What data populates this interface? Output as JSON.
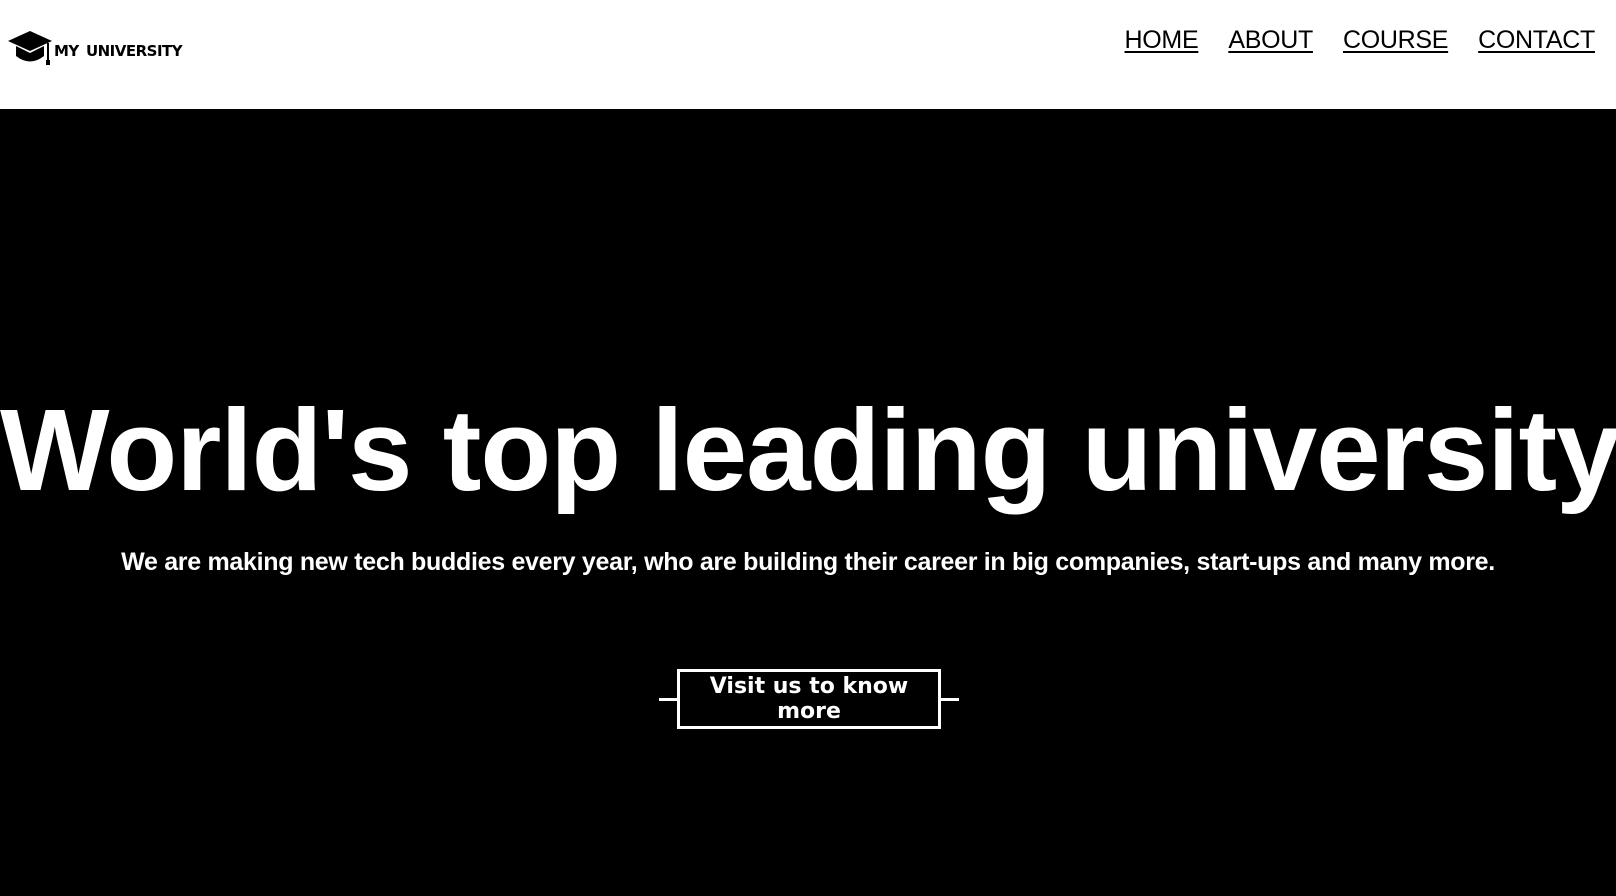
{
  "brand": {
    "name": "my university",
    "icon": "graduation-cap-icon"
  },
  "nav": {
    "items": [
      {
        "label": "HOME"
      },
      {
        "label": "ABOUT"
      },
      {
        "label": "COURSE"
      },
      {
        "label": "CONTACT"
      }
    ]
  },
  "hero": {
    "title": "World's top leading university",
    "subtitle": "We are making new tech buddies every year, who are building their career in big companies, start-ups and many more.",
    "cta_label": "Visit us to know more"
  },
  "colors": {
    "navbar_bg": "#ffffff",
    "hero_bg": "#000000",
    "hero_text": "#ffffff",
    "nav_text": "#000000"
  }
}
